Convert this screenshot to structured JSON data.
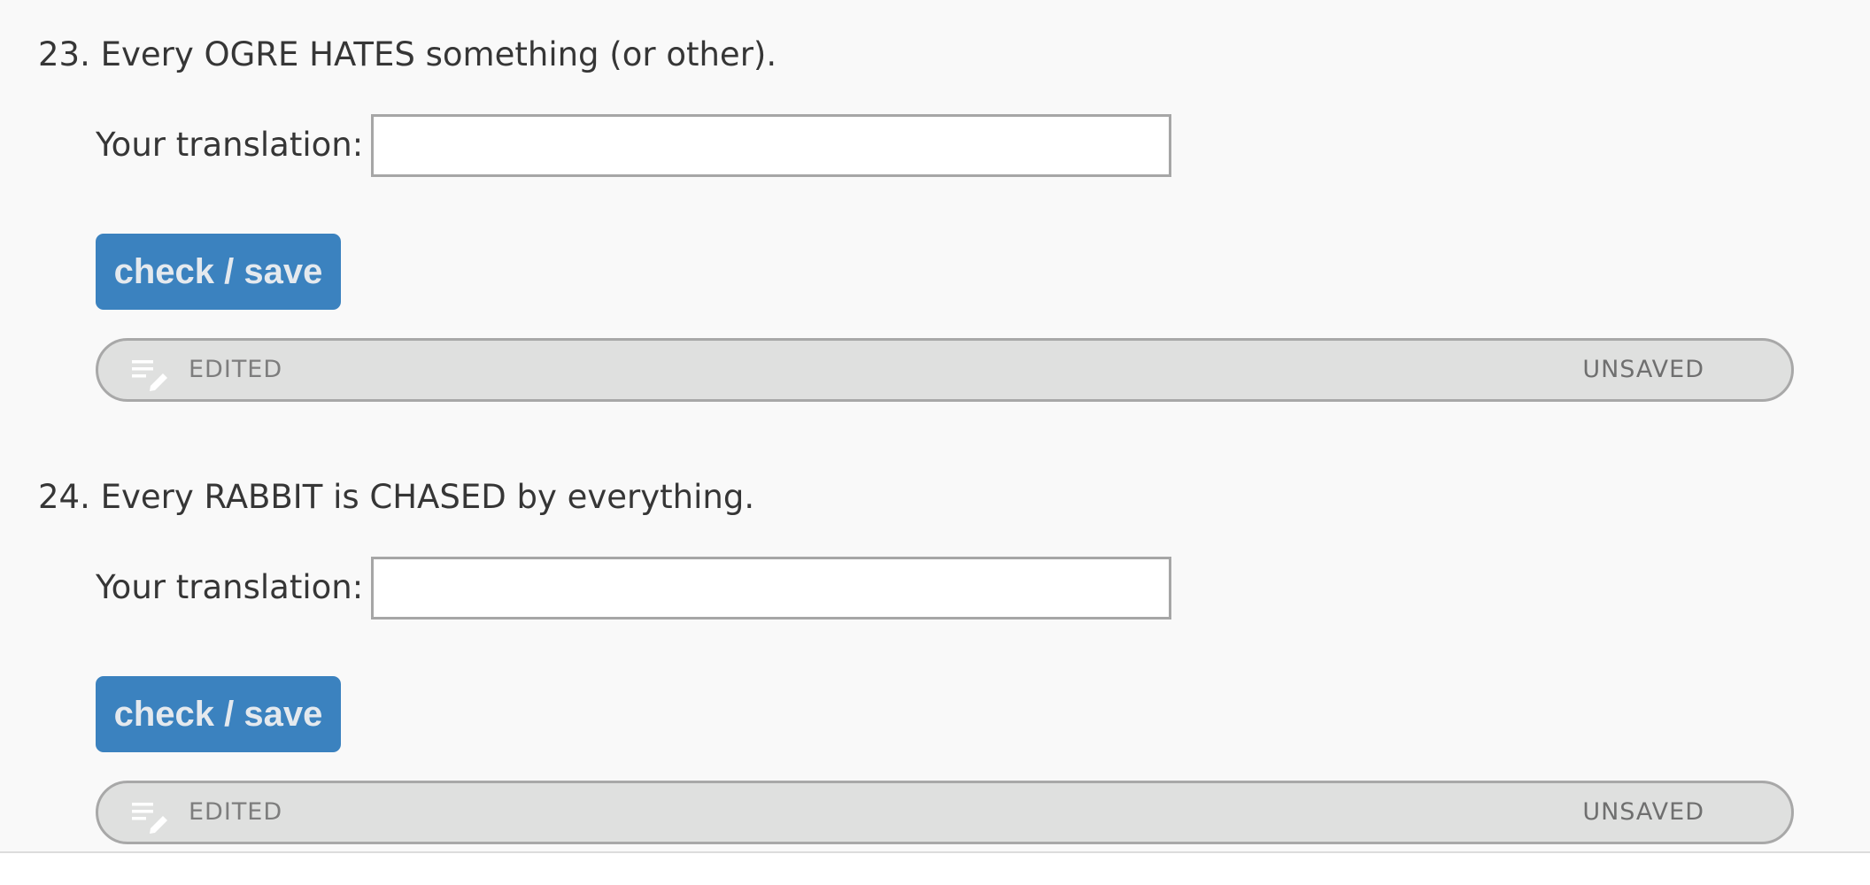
{
  "questions": [
    {
      "prompt": "23. Every OGRE HATES something (or other).",
      "translation_label": "Your translation:",
      "translation_value": "",
      "button_label": "check / save",
      "status_left": "EDITED",
      "status_right": "UNSAVED",
      "status_icon": "edit-note-icon"
    },
    {
      "prompt": "24. Every RABBIT is CHASED by everything.",
      "translation_label": "Your translation:",
      "translation_value": "",
      "button_label": "check / save",
      "status_left": "EDITED",
      "status_right": "UNSAVED",
      "status_icon": "edit-note-icon"
    }
  ],
  "colors": {
    "page_background": "#f9f9f9",
    "button": "#3b82bf",
    "button_text": "#e4e9ee",
    "status_bar": "#dfe0df",
    "status_text": "#7d7d7d"
  }
}
